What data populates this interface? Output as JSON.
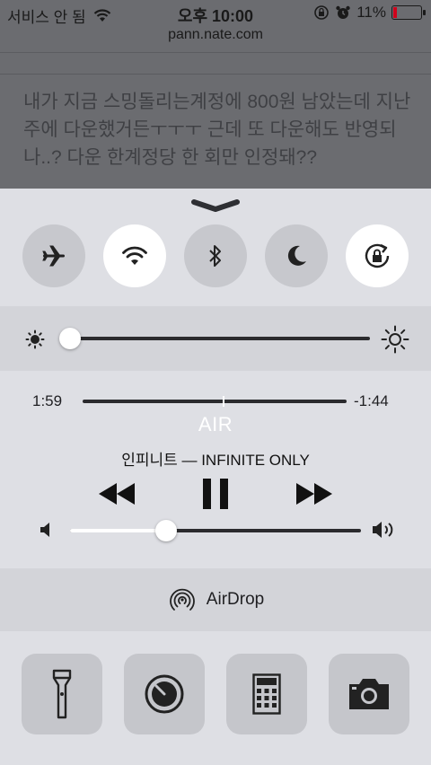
{
  "status_bar": {
    "carrier": "서비스 안 됨",
    "time": "오후 10:00",
    "battery": "11%",
    "battery_level": 0.11
  },
  "browser": {
    "url": "pann.nate.com",
    "post_text": "내가 지금 스밍돌리는계정에 800원 남았는데 지난주에 다운했거든ㅜㅜㅜ 근데 또 다운해도 반영되나..? 다운 한계정당 한 회만 인정돼??"
  },
  "control_center": {
    "toggles": [
      {
        "name": "airplane-mode",
        "icon": "airplane-icon",
        "on": false
      },
      {
        "name": "wifi",
        "icon": "wifi-icon",
        "on": true
      },
      {
        "name": "bluetooth",
        "icon": "bluetooth-icon",
        "on": false
      },
      {
        "name": "do-not-disturb",
        "icon": "moon-icon",
        "on": false
      },
      {
        "name": "orientation-lock",
        "icon": "rotation-lock-icon",
        "on": true
      }
    ],
    "brightness_level": 0.0,
    "music": {
      "elapsed": "1:59",
      "remaining": "-1:44",
      "progress": 0.53,
      "title": "AIR",
      "artist_album": "인피니트 — INFINITE ONLY",
      "volume_level": 0.33
    },
    "airdrop_label": "AirDrop",
    "shortcuts": [
      "flashlight-icon",
      "timer-icon",
      "calculator-icon",
      "camera-icon"
    ]
  },
  "colors": {
    "dimmed_background": "#6b6c70",
    "panel": "#dedfe4",
    "toggle_on": "#ffffff",
    "toggle_off": "#c7c8cd",
    "battery_low": "#d0021b"
  }
}
